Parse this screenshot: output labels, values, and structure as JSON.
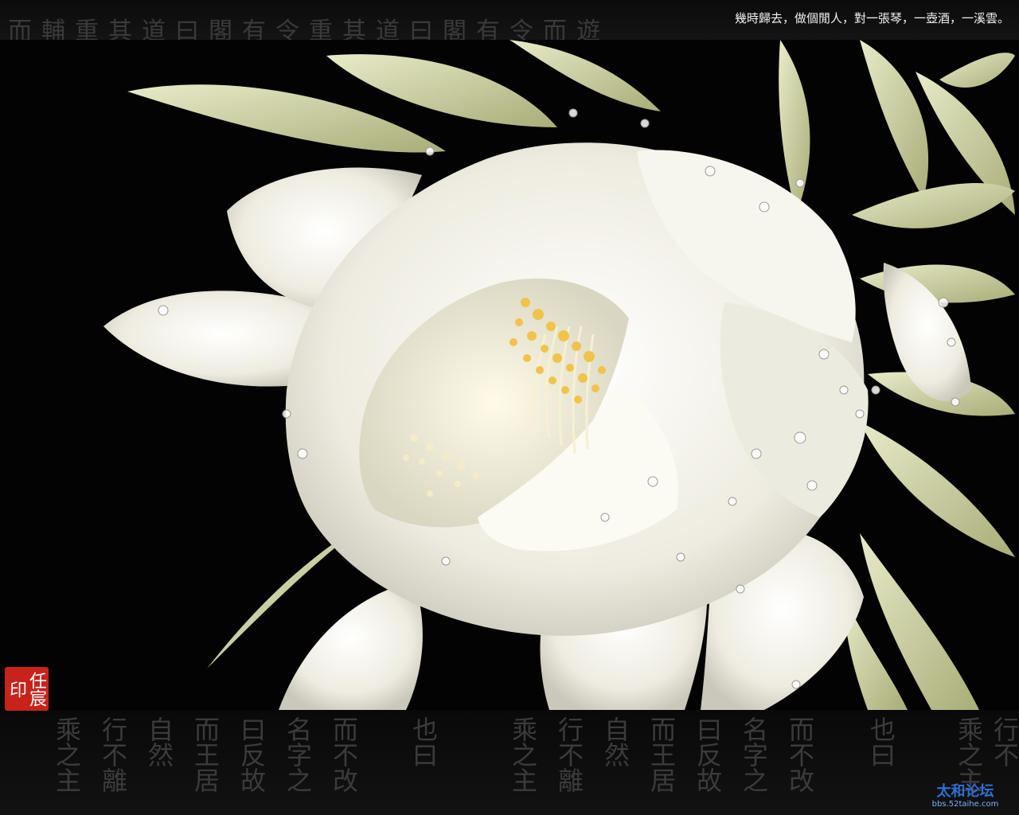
{
  "poem": "幾時歸去，做個閒人，對一張琴，一壺酒，一溪雲。",
  "top_calligraphy": "而輔重其道曰閣有令重其道曰閣有令而遊",
  "bottom_calligraphy": [
    "乘之主",
    "行不離",
    "自然",
    "而王居",
    "曰反故",
    "名字之",
    "而不改",
    "也曰",
    "乘之主",
    "行不離",
    "自然",
    "而王居",
    "曰反故",
    "名字之",
    "而不改",
    "也曰",
    "乘之主",
    "行不"
  ],
  "seal_text": "任宸印",
  "watermark": {
    "name": "太和论坛",
    "url": "bbs.52taihe.com"
  },
  "colors": {
    "background": "#030303",
    "petal": "#f3f1e6",
    "sepal": "#d7dcae",
    "stamen": "#f0c44a",
    "seal": "#c8231b",
    "watermark": "#2f6fd6"
  },
  "subject": "flower-icon"
}
